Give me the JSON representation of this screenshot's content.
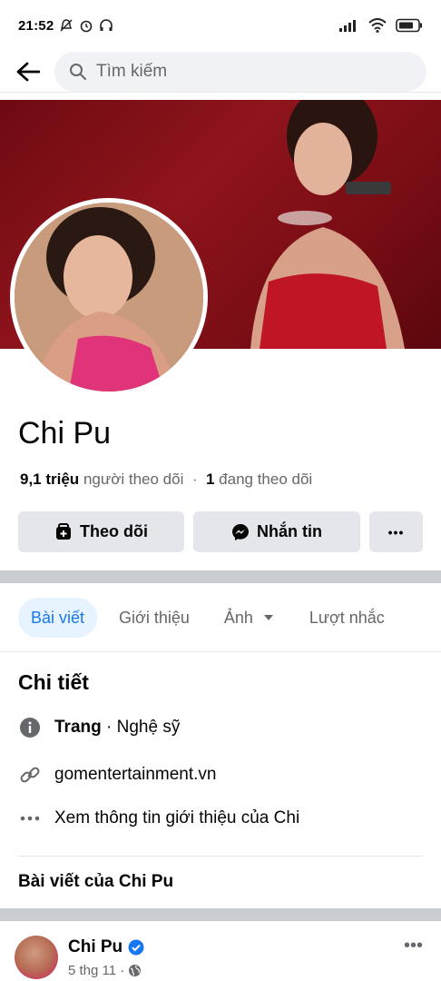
{
  "status_bar": {
    "time": "21:52"
  },
  "search": {
    "placeholder": "Tìm kiếm"
  },
  "profile": {
    "name": "Chi Pu",
    "followers_count": "9,1 triệu",
    "followers_label": "người theo dõi",
    "separator": "·",
    "following_count": "1",
    "following_label": "đang theo dõi"
  },
  "actions": {
    "follow": "Theo dõi",
    "message": "Nhắn tin",
    "more": "•••"
  },
  "tabs": [
    {
      "label": "Bài viết",
      "active": true
    },
    {
      "label": "Giới thiệu",
      "active": false
    },
    {
      "label": "Ảnh",
      "active": false
    },
    {
      "label": "Lượt nhắc",
      "active": false
    }
  ],
  "details": {
    "title": "Chi tiết",
    "page_type_bold": "Trang",
    "page_type_rest": " · Nghệ sỹ",
    "website": "gomentertainment.vn",
    "more_info": "Xem thông tin giới thiệu của Chi"
  },
  "posts": {
    "title": "Bài viết của Chi Pu",
    "first": {
      "author": "Chi Pu",
      "date": "5 thg 11 ·"
    }
  },
  "colors": {
    "accent": "#1877f2",
    "cover": "#7a0d15",
    "button_bg": "#e4e6eb"
  },
  "icons": [
    "back-arrow-icon",
    "search-icon",
    "follow-icon",
    "messenger-icon",
    "more-icon",
    "info-icon",
    "link-icon",
    "dots-icon",
    "verified-icon",
    "globe-icon",
    "chevron-down-icon"
  ]
}
